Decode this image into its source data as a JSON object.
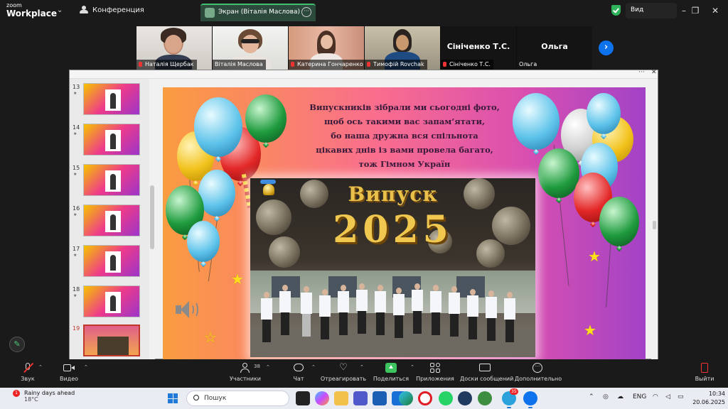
{
  "app": {
    "logo_line1": "zoom",
    "logo_line2": "Workplace"
  },
  "topbar": {
    "conference_label": "Конференция",
    "screen_tab_label": "Экран (Віталія Маслова)",
    "view_label": "Вид"
  },
  "participants": [
    {
      "name": "Наталія Щербак",
      "muted": true
    },
    {
      "name": "Віталія Маслова",
      "muted": false
    },
    {
      "name": "Катерина Гончаренко",
      "muted": true
    },
    {
      "name": "Тимофій Rovchak",
      "muted": true
    },
    {
      "name": "Сініченко Т.С.",
      "display": "Сініченко Т.С.",
      "muted": true
    },
    {
      "name": "Ольга",
      "display": "Ольга",
      "muted": false
    }
  ],
  "slides": {
    "numbers": [
      "13",
      "14",
      "15",
      "16",
      "17",
      "18",
      "19"
    ],
    "current": "19"
  },
  "slide": {
    "poem": [
      "Випускників   зібрали ми сьогодні фото,",
      "щоб ось такими вас запам’ятати,",
      "бо наша дружна вся спільнота",
      "цікавих днів із вами провела багато,",
      "тож Гімном Україн"
    ],
    "heading": "Випуск",
    "year": "2025"
  },
  "toolbar": {
    "audio_label": "Звук",
    "video_label": "Видео",
    "participants_label": "Участники",
    "participants_count": "38",
    "chat_label": "Чат",
    "react_label": "Отреагировать",
    "share_label": "Поделиться",
    "apps_label": "Приложения",
    "whiteboards_label": "Доски сообщений",
    "more_label": "Дополнительно",
    "leave_label": "Выйти"
  },
  "taskbar": {
    "weather_title": "Rainy days ahead",
    "weather_temp": "18°C",
    "weather_badge": "1",
    "search_placeholder": "Пошук",
    "lang": "ENG",
    "time": "10:34",
    "date": "20.06.2025",
    "telegram_badge": "35"
  },
  "colors": {
    "accent_green": "#3cc45f",
    "zoom_blue": "#0e72ed"
  }
}
